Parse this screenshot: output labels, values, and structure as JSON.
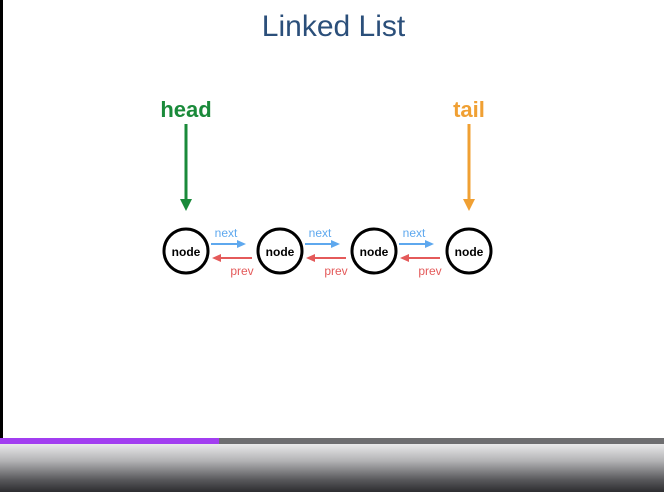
{
  "slide": {
    "title": "Linked List",
    "head_label": "head",
    "tail_label": "tail",
    "nodes": [
      "node",
      "node",
      "node",
      "node"
    ],
    "next_label": "next",
    "prev_label": "prev"
  },
  "colors": {
    "title": "#2b4f7a",
    "head": "#1a8a3a",
    "tail": "#f0a033",
    "next": "#5ea8ee",
    "prev": "#e45a5a",
    "progress": "#a23ef0"
  },
  "player": {
    "progress": 0.33
  }
}
